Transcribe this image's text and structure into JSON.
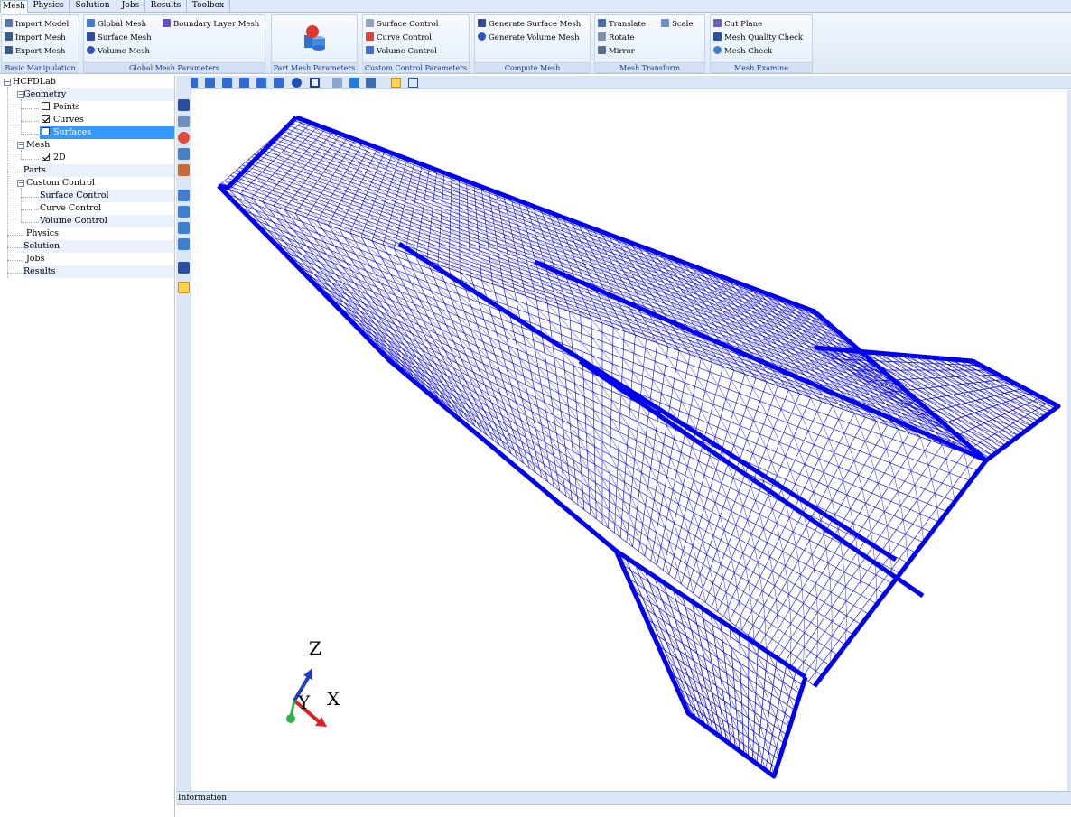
{
  "menu": {
    "tabs": [
      "Mesh",
      "Physics",
      "Solution",
      "Jobs",
      "Results",
      "Toolbox"
    ],
    "active_tab": "Mesh"
  },
  "ribbon": {
    "basic_manipulation": {
      "title": "Basic Manipulation",
      "import_model": "Import Model",
      "import_mesh": "Import Mesh",
      "export_mesh": "Export Mesh"
    },
    "global_mesh_parameters": {
      "title": "Global Mesh Parameters",
      "global_mesh": "Global Mesh",
      "boundary_layer_mesh": "Boundary Layer Mesh",
      "surface_mesh": "Surface Mesh",
      "volume_mesh": "Volume Mesh"
    },
    "part_mesh_parameters": {
      "title": "Part Mesh Parameters"
    },
    "custom_control_parameters": {
      "title": "Custom Control Parameters",
      "surface_control": "Surface Control",
      "curve_control": "Curve Control",
      "volume_control": "Volume Control"
    },
    "compute_mesh": {
      "title": "Compute Mesh",
      "generate_surface_mesh": "Generate Surface Mesh",
      "generate_volume_mesh": "Generate Volume Mesh"
    },
    "mesh_transform": {
      "title": "Mesh Transform",
      "translate": "Translate",
      "scale": "Scale",
      "rotate": "Rotate",
      "mirror": "Mirror"
    },
    "mesh_examine": {
      "title": "Mesh Examine",
      "cut_plane": "Cut Plane",
      "mesh_quality_check": "Mesh Quality Check",
      "mesh_check": "Mesh Check"
    }
  },
  "tree": {
    "root": "HCFDLab",
    "geometry": "Geometry",
    "points": "Points",
    "points_checked": false,
    "curves": "Curves",
    "curves_checked": true,
    "surfaces": "Surfaces",
    "surfaces_checked": false,
    "mesh": "Mesh",
    "mesh_2d": "2D",
    "mesh_2d_checked": true,
    "parts": "Parts",
    "custom_control": "Custom Control",
    "surface_control": "Surface Control",
    "curve_control": "Curve Control",
    "volume_control": "Volume Control",
    "physics": "Physics",
    "solution": "Solution",
    "jobs": "Jobs",
    "results": "Results"
  },
  "viewport": {
    "mesh_color": "#0000ee",
    "axes": {
      "z": "Z",
      "y": "Y",
      "x": "X"
    },
    "axis_colors": {
      "z": "#1f3fbf",
      "y": "#2db34a",
      "x": "#e02020"
    }
  },
  "info_panel": {
    "title": "Information"
  },
  "colors": {
    "ribbon_title": "#15428b",
    "selection": "#3399ff",
    "panel": "#dbe6f4"
  }
}
